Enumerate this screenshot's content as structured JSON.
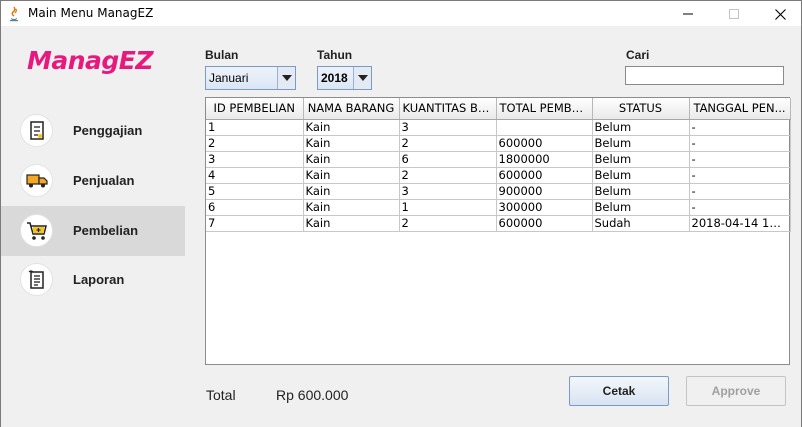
{
  "window": {
    "title": "Main Menu ManagEZ"
  },
  "sidebar": {
    "logo": "ManagEZ",
    "items": [
      {
        "label": "Penggajian",
        "icon": "receipt-icon"
      },
      {
        "label": "Penjualan",
        "icon": "truck-icon"
      },
      {
        "label": "Pembelian",
        "icon": "cart-icon",
        "active": true
      },
      {
        "label": "Laporan",
        "icon": "report-icon"
      }
    ]
  },
  "filters": {
    "bulan_label": "Bulan",
    "bulan_value": "Januari",
    "tahun_label": "Tahun",
    "tahun_value": "2018",
    "cari_label": "Cari",
    "cari_value": ""
  },
  "table": {
    "columns": [
      "ID PEMBELIAN",
      "NAMA BARANG",
      "KUANTITAS BA...",
      "TOTAL PEMBE...",
      "STATUS",
      "TANGGAL PEN..."
    ],
    "rows": [
      [
        "1",
        "Kain",
        "3",
        "",
        "Belum",
        "-"
      ],
      [
        "2",
        "Kain",
        "2",
        "600000",
        "Belum",
        "-"
      ],
      [
        "3",
        "Kain",
        "6",
        "1800000",
        "Belum",
        "-"
      ],
      [
        "4",
        "Kain",
        "2",
        "600000",
        "Belum",
        "-"
      ],
      [
        "5",
        "Kain",
        "3",
        "900000",
        "Belum",
        "-"
      ],
      [
        "6",
        "Kain",
        "1",
        "300000",
        "Belum",
        "-"
      ],
      [
        "7",
        "Kain",
        "2",
        "600000",
        "Sudah",
        "2018-04-14 16:..."
      ]
    ]
  },
  "footer": {
    "total_label": "Total",
    "total_value": "Rp 600.000",
    "cetak_label": "Cetak",
    "approve_label": "Approve"
  },
  "colors": {
    "brand": "#e8197d",
    "active_nav": "#d9d9d9"
  }
}
